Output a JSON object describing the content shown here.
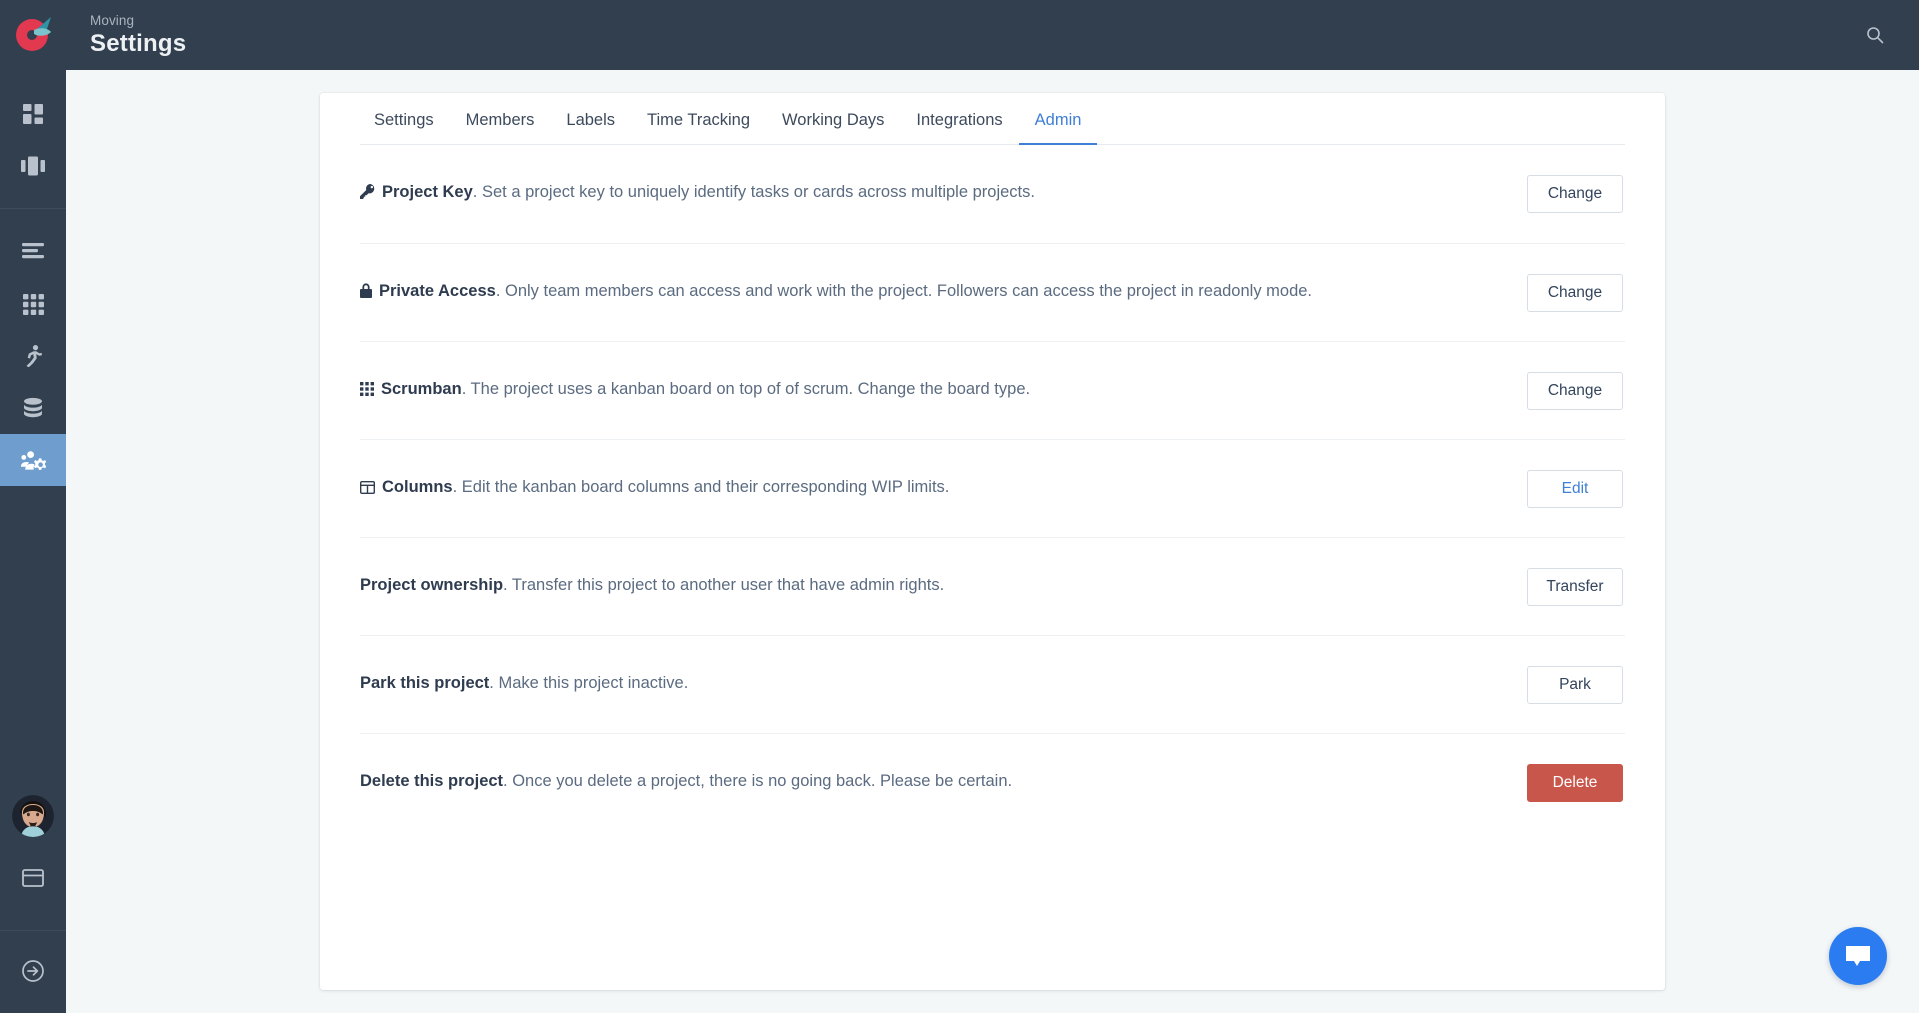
{
  "header": {
    "eyebrow": "Moving",
    "title": "Settings",
    "search_icon": "search-icon"
  },
  "sidebar": {
    "groups": [
      {
        "items": [
          {
            "icon": "dashboard-icon",
            "name": "sidebar-item-dashboard",
            "active": false
          },
          {
            "icon": "kanban-icon",
            "name": "sidebar-item-board",
            "active": false
          }
        ]
      },
      {
        "items": [
          {
            "icon": "backlog-icon",
            "name": "sidebar-item-backlog",
            "active": false
          },
          {
            "icon": "grid-icon",
            "name": "sidebar-item-grid",
            "active": false
          },
          {
            "icon": "sprint-icon",
            "name": "sidebar-item-sprints",
            "active": false
          },
          {
            "icon": "database-icon",
            "name": "sidebar-item-archive",
            "active": false
          },
          {
            "icon": "team-settings-icon",
            "name": "sidebar-item-settings",
            "active": true
          }
        ]
      }
    ],
    "bottom": {
      "avatar": "user-avatar",
      "billing_icon": "card-icon",
      "logout_icon": "logout-icon"
    }
  },
  "tabs": [
    {
      "label": "Settings",
      "active": false
    },
    {
      "label": "Members",
      "active": false
    },
    {
      "label": "Labels",
      "active": false
    },
    {
      "label": "Time Tracking",
      "active": false
    },
    {
      "label": "Working Days",
      "active": false
    },
    {
      "label": "Integrations",
      "active": false
    },
    {
      "label": "Admin",
      "active": true
    }
  ],
  "rows": [
    {
      "icon": "key-icon",
      "title": "Project Key",
      "desc": ". Set a project key to uniquely identify tasks or cards across multiple projects.",
      "button": {
        "label": "Change",
        "style": "default",
        "name": "change-project-key-button"
      }
    },
    {
      "icon": "lock-icon",
      "title": "Private Access",
      "desc": ". Only team members can access and work with the project. Followers can access the project in readonly mode.",
      "button": {
        "label": "Change",
        "style": "default",
        "name": "change-private-access-button"
      }
    },
    {
      "icon": "grid-3x3-icon",
      "title": "Scrumban",
      "desc": ". The project uses a kanban board on top of of scrum. Change the board type.",
      "button": {
        "label": "Change",
        "style": "default",
        "name": "change-board-type-button"
      }
    },
    {
      "icon": "columns-icon",
      "title": "Columns",
      "desc": ". Edit the kanban board columns and their corresponding WIP limits.",
      "button": {
        "label": "Edit",
        "style": "link",
        "name": "edit-columns-button"
      }
    },
    {
      "icon": "none",
      "title": "Project ownership",
      "desc": ". Transfer this project to another user that have admin rights.",
      "button": {
        "label": "Transfer",
        "style": "default",
        "name": "transfer-ownership-button"
      }
    },
    {
      "icon": "none",
      "title": "Park this project",
      "desc": ". Make this project inactive.",
      "button": {
        "label": "Park",
        "style": "default",
        "name": "park-project-button"
      }
    },
    {
      "icon": "none",
      "title": "Delete this project",
      "desc": ". Once you delete a project, there is no going back. Please be certain.",
      "button": {
        "label": "Delete",
        "style": "danger",
        "name": "delete-project-button"
      }
    }
  ],
  "chat": {
    "icon": "chat-bubble-icon"
  },
  "colors": {
    "chrome": "#323f4e",
    "page_bg": "#f4f7f8",
    "accent_blue": "#3f7fd6",
    "active_nav": "#6f9ece",
    "danger": "#c9564b",
    "logo_red": "#e23850",
    "logo_teal": "#2f93a5",
    "chat_blue": "#2b7cf0"
  }
}
